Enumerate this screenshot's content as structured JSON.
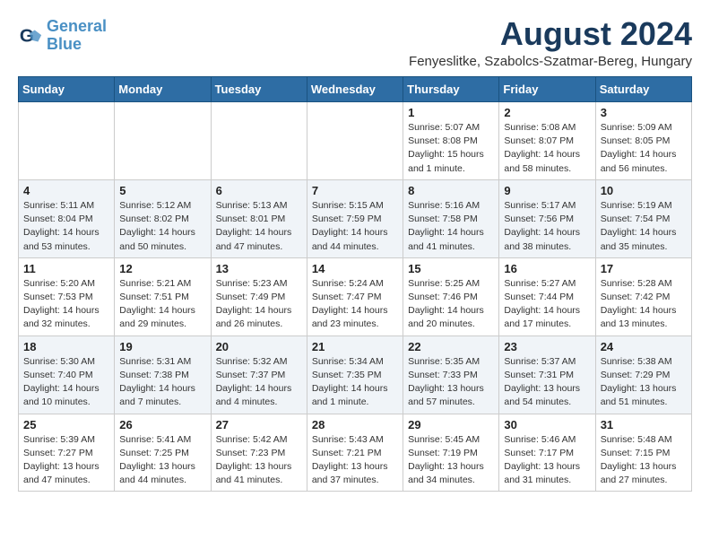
{
  "header": {
    "logo_line1": "General",
    "logo_line2": "Blue",
    "month_year": "August 2024",
    "location": "Fenyeslitke, Szabolcs-Szatmar-Bereg, Hungary"
  },
  "days_of_week": [
    "Sunday",
    "Monday",
    "Tuesday",
    "Wednesday",
    "Thursday",
    "Friday",
    "Saturday"
  ],
  "weeks": [
    [
      {
        "day": "",
        "info": ""
      },
      {
        "day": "",
        "info": ""
      },
      {
        "day": "",
        "info": ""
      },
      {
        "day": "",
        "info": ""
      },
      {
        "day": "1",
        "info": "Sunrise: 5:07 AM\nSunset: 8:08 PM\nDaylight: 15 hours and 1 minute."
      },
      {
        "day": "2",
        "info": "Sunrise: 5:08 AM\nSunset: 8:07 PM\nDaylight: 14 hours and 58 minutes."
      },
      {
        "day": "3",
        "info": "Sunrise: 5:09 AM\nSunset: 8:05 PM\nDaylight: 14 hours and 56 minutes."
      }
    ],
    [
      {
        "day": "4",
        "info": "Sunrise: 5:11 AM\nSunset: 8:04 PM\nDaylight: 14 hours and 53 minutes."
      },
      {
        "day": "5",
        "info": "Sunrise: 5:12 AM\nSunset: 8:02 PM\nDaylight: 14 hours and 50 minutes."
      },
      {
        "day": "6",
        "info": "Sunrise: 5:13 AM\nSunset: 8:01 PM\nDaylight: 14 hours and 47 minutes."
      },
      {
        "day": "7",
        "info": "Sunrise: 5:15 AM\nSunset: 7:59 PM\nDaylight: 14 hours and 44 minutes."
      },
      {
        "day": "8",
        "info": "Sunrise: 5:16 AM\nSunset: 7:58 PM\nDaylight: 14 hours and 41 minutes."
      },
      {
        "day": "9",
        "info": "Sunrise: 5:17 AM\nSunset: 7:56 PM\nDaylight: 14 hours and 38 minutes."
      },
      {
        "day": "10",
        "info": "Sunrise: 5:19 AM\nSunset: 7:54 PM\nDaylight: 14 hours and 35 minutes."
      }
    ],
    [
      {
        "day": "11",
        "info": "Sunrise: 5:20 AM\nSunset: 7:53 PM\nDaylight: 14 hours and 32 minutes."
      },
      {
        "day": "12",
        "info": "Sunrise: 5:21 AM\nSunset: 7:51 PM\nDaylight: 14 hours and 29 minutes."
      },
      {
        "day": "13",
        "info": "Sunrise: 5:23 AM\nSunset: 7:49 PM\nDaylight: 14 hours and 26 minutes."
      },
      {
        "day": "14",
        "info": "Sunrise: 5:24 AM\nSunset: 7:47 PM\nDaylight: 14 hours and 23 minutes."
      },
      {
        "day": "15",
        "info": "Sunrise: 5:25 AM\nSunset: 7:46 PM\nDaylight: 14 hours and 20 minutes."
      },
      {
        "day": "16",
        "info": "Sunrise: 5:27 AM\nSunset: 7:44 PM\nDaylight: 14 hours and 17 minutes."
      },
      {
        "day": "17",
        "info": "Sunrise: 5:28 AM\nSunset: 7:42 PM\nDaylight: 14 hours and 13 minutes."
      }
    ],
    [
      {
        "day": "18",
        "info": "Sunrise: 5:30 AM\nSunset: 7:40 PM\nDaylight: 14 hours and 10 minutes."
      },
      {
        "day": "19",
        "info": "Sunrise: 5:31 AM\nSunset: 7:38 PM\nDaylight: 14 hours and 7 minutes."
      },
      {
        "day": "20",
        "info": "Sunrise: 5:32 AM\nSunset: 7:37 PM\nDaylight: 14 hours and 4 minutes."
      },
      {
        "day": "21",
        "info": "Sunrise: 5:34 AM\nSunset: 7:35 PM\nDaylight: 14 hours and 1 minute."
      },
      {
        "day": "22",
        "info": "Sunrise: 5:35 AM\nSunset: 7:33 PM\nDaylight: 13 hours and 57 minutes."
      },
      {
        "day": "23",
        "info": "Sunrise: 5:37 AM\nSunset: 7:31 PM\nDaylight: 13 hours and 54 minutes."
      },
      {
        "day": "24",
        "info": "Sunrise: 5:38 AM\nSunset: 7:29 PM\nDaylight: 13 hours and 51 minutes."
      }
    ],
    [
      {
        "day": "25",
        "info": "Sunrise: 5:39 AM\nSunset: 7:27 PM\nDaylight: 13 hours and 47 minutes."
      },
      {
        "day": "26",
        "info": "Sunrise: 5:41 AM\nSunset: 7:25 PM\nDaylight: 13 hours and 44 minutes."
      },
      {
        "day": "27",
        "info": "Sunrise: 5:42 AM\nSunset: 7:23 PM\nDaylight: 13 hours and 41 minutes."
      },
      {
        "day": "28",
        "info": "Sunrise: 5:43 AM\nSunset: 7:21 PM\nDaylight: 13 hours and 37 minutes."
      },
      {
        "day": "29",
        "info": "Sunrise: 5:45 AM\nSunset: 7:19 PM\nDaylight: 13 hours and 34 minutes."
      },
      {
        "day": "30",
        "info": "Sunrise: 5:46 AM\nSunset: 7:17 PM\nDaylight: 13 hours and 31 minutes."
      },
      {
        "day": "31",
        "info": "Sunrise: 5:48 AM\nSunset: 7:15 PM\nDaylight: 13 hours and 27 minutes."
      }
    ]
  ]
}
